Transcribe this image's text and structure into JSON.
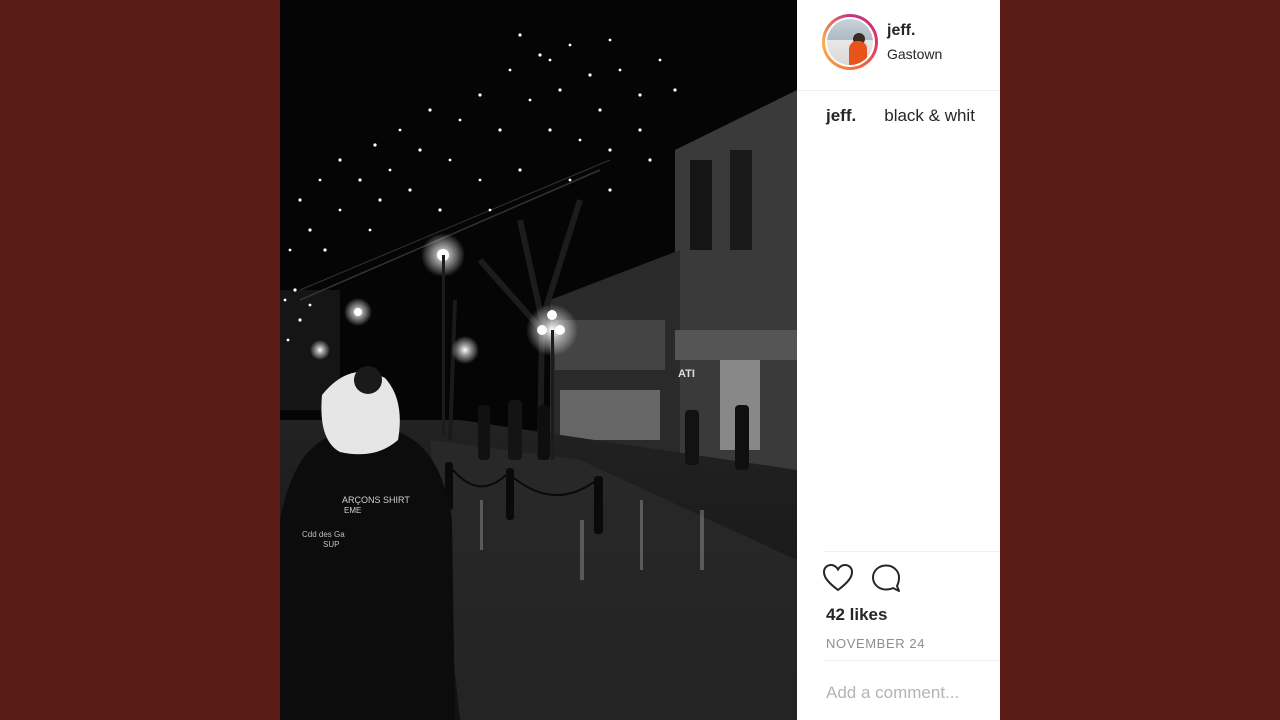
{
  "post": {
    "username": "jeff.",
    "location": "Gastown",
    "caption": {
      "username": "jeff.",
      "text": "black & whit"
    },
    "likes": "42 likes",
    "date": "NOVEMBER 24",
    "comment_placeholder": "Add a comment...",
    "photo_text": {
      "jacket_line1": "ARÇONS SHIRT",
      "jacket_line2": "EME",
      "jacket_line3": "Cdd des Ga",
      "jacket_line4": "SUP",
      "store_sign": "ATI"
    }
  },
  "icons": {
    "like": "heart-icon",
    "comment": "comment-bubble-icon"
  },
  "colors": {
    "background": "#5a1c16",
    "text": "#262626",
    "muted": "#8e8e8e"
  }
}
